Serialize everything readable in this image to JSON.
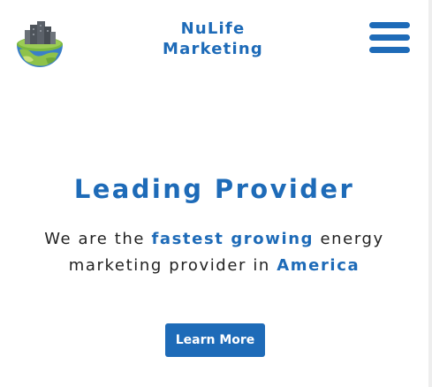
{
  "header": {
    "brand_line1": "NuLife",
    "brand_line2": "Marketing",
    "logo_icon": "globe-city-logo-icon",
    "menu_icon": "hamburger-menu-icon"
  },
  "hero": {
    "title": "Leading Provider",
    "text_part1": "We are the",
    "highlight1": "fastest growing",
    "text_part2": "energy marketing provider in",
    "highlight2": "America",
    "button_label": "Learn More"
  },
  "colors": {
    "brand": "#1e6bb8",
    "text": "#222222",
    "background": "#ffffff"
  }
}
